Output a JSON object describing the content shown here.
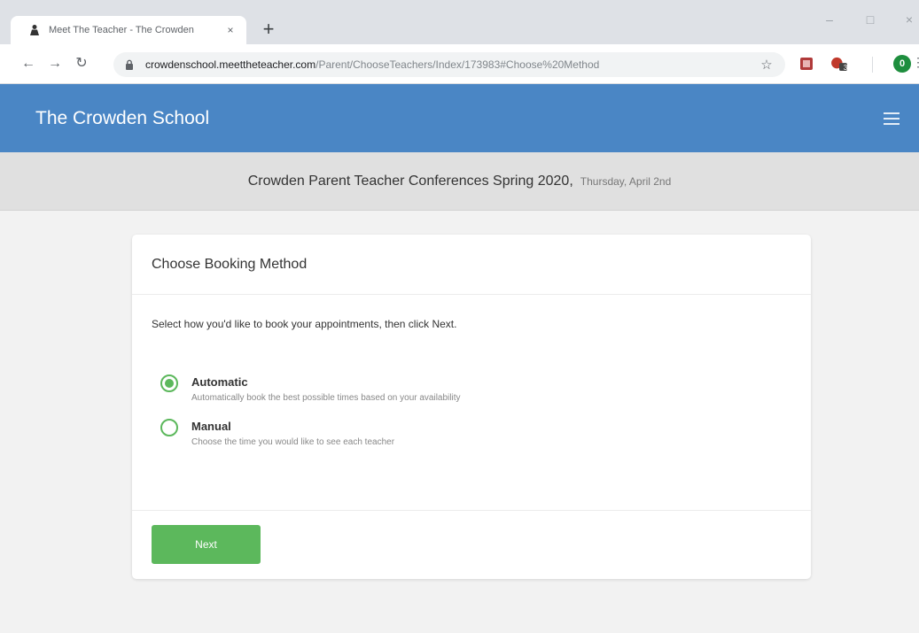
{
  "browser": {
    "tab_title": "Meet The Teacher - The Crowden",
    "tab_close": "×",
    "new_tab": "+",
    "window_minimize": "–",
    "window_maximize": "□",
    "window_close": "×",
    "url_host": "crowdenschool.meettheteacher.com",
    "url_path": "/Parent/ChooseTeachers/Index/173983#Choose%20Method",
    "profile_initial": "0",
    "extension_badge": "3",
    "colors": {
      "tabstrip": "#dee1e6",
      "profile": "#1e8e3e"
    }
  },
  "site": {
    "title": "The Crowden School",
    "header_color": "#4a86c5"
  },
  "event": {
    "name": "Crowden Parent Teacher Conferences Spring 2020,",
    "date": "Thursday, April 2nd"
  },
  "booking": {
    "card_title": "Choose Booking Method",
    "instructions": "Select how you'd like to book your appointments, then click Next.",
    "options": [
      {
        "label": "Automatic",
        "description": "Automatically book the best possible times based on your availability",
        "selected": true
      },
      {
        "label": "Manual",
        "description": "Choose the time you would like to see each teacher",
        "selected": false
      }
    ],
    "next_label": "Next",
    "accent_color": "#5cb85c"
  }
}
